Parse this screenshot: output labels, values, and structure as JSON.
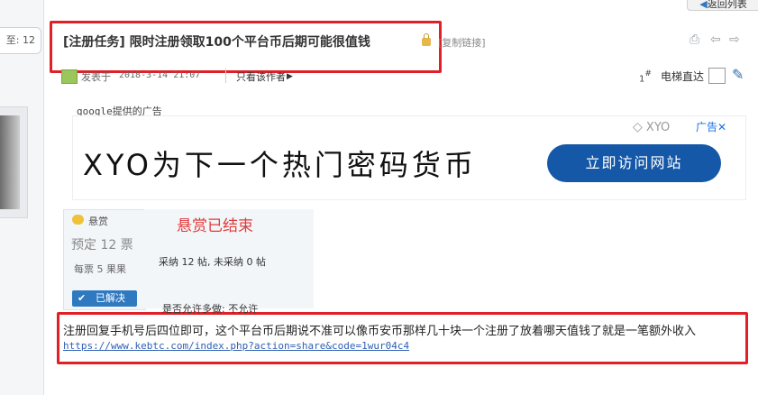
{
  "nav": {
    "back_label": "返回列表"
  },
  "sidebar": {
    "floor_label": "至: 12"
  },
  "thread": {
    "title": "[注册任务] 限时注册领取100个平台币后期可能很值钱",
    "copy_link": "[复制链接]"
  },
  "post": {
    "posted_prefix": "发表于",
    "timestamp": "2018-3-14 21:07",
    "only_author": "只看该作者",
    "floor_num": "1",
    "floor_mark": "#",
    "elevator": "电梯直达"
  },
  "ad": {
    "label": "google提供的广告",
    "headline": "XYO为下一个热门密码货币",
    "logo": "XYO",
    "tag": "广告",
    "close": "✕",
    "cta": "立即访问网站"
  },
  "bounty": {
    "label": "悬赏",
    "amount": "预定 12 票",
    "per": "每票 5 果果",
    "solved": "已解决",
    "ended": "悬赏已结束",
    "adopted": "采纳 12 帖, 未采纳 0 帖",
    "multi": "是否允许多做: 不允许"
  },
  "content": {
    "text": "注册回复手机号后四位即可，这个平台币后期说不准可以像币安币那样几十块一个注册了放着哪天值钱了就是一笔额外收入",
    "link": "https://www.kebtc.com/index.php?action=share&code=1wur04c4"
  },
  "icons": [
    "print-icon",
    "prev-icon",
    "next-icon",
    "lock-icon",
    "user-icon",
    "arrow-right-icon",
    "pencil-icon",
    "coin-icon",
    "check-icon",
    "close-icon"
  ],
  "colors": {
    "accent": "#2f79c1",
    "highlight_box": "#e01f27",
    "ad_button": "#1558a8",
    "bounty_ended": "#e03a3a"
  }
}
